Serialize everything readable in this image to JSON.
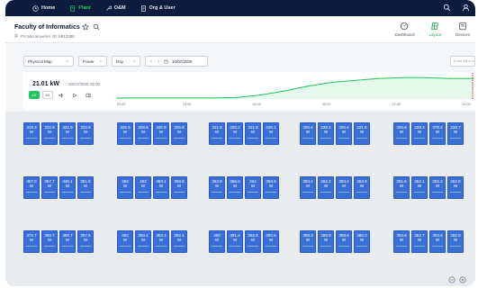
{
  "nav": {
    "items": [
      {
        "label": "Home",
        "icon": "clock-icon",
        "active": false
      },
      {
        "label": "Plant",
        "icon": "plant-icon",
        "active": true
      },
      {
        "label": "O&M",
        "icon": "wrench-icon",
        "active": false
      },
      {
        "label": "Org & User",
        "icon": "org-icon",
        "active": false
      }
    ]
  },
  "header": {
    "title": "Faculty of Informatics",
    "device_type": "PV Microinverter",
    "device_id": "ID: 5913300",
    "views": [
      {
        "label": "Dashboard",
        "active": false
      },
      {
        "label": "Layout",
        "active": true
      },
      {
        "label": "Devices",
        "active": false
      }
    ]
  },
  "filters": {
    "map": "Physical Map",
    "metric": "Power",
    "granularity": "Day",
    "date": "10/07/2025",
    "search_placeholder": "Enter SN to search"
  },
  "chart_panel": {
    "power": "21.01 kW",
    "timestamp": "10/07/2025 15:00",
    "controls": [
      "1X",
      "2X"
    ]
  },
  "chart_data": {
    "type": "area",
    "x_ticks": [
      "00:00",
      "03:00",
      "06:00",
      "09:00",
      "12:00",
      "15:00"
    ],
    "x": [
      "00:00",
      "01:00",
      "02:00",
      "03:00",
      "04:00",
      "05:00",
      "06:00",
      "07:00",
      "08:00",
      "09:00",
      "10:00",
      "11:00",
      "12:00",
      "13:00",
      "14:00",
      "15:00"
    ],
    "values": [
      1,
      1,
      1,
      1,
      1,
      1.5,
      4,
      8,
      13,
      17,
      19,
      21,
      22,
      22,
      21,
      21
    ],
    "cursor": "15:00",
    "color": "#22c55e"
  },
  "panels": {
    "unit": "W",
    "blocks": [
      [
        "319.3",
        "322.9",
        "322.9",
        "322.8"
      ],
      [
        "326.6",
        "328.6",
        "330.8",
        "326.8"
      ],
      [
        "331.8",
        "333.2",
        "331.8",
        "336.1"
      ],
      [
        "326.4",
        "326.4",
        "325.4",
        "321.6"
      ],
      [
        "326.8",
        "328.3",
        "378.2",
        "318.7"
      ],
      [
        "357.8",
        "357.7",
        "345.1",
        "351.5"
      ],
      [
        "363",
        "362",
        "360.1",
        "358.8"
      ],
      [
        "363.8",
        "366.2",
        "364",
        "363.5"
      ],
      [
        "353.4",
        "352.2",
        "353.4",
        "353.9"
      ],
      [
        "351.6",
        "352.1",
        "352.2",
        "352.8"
      ],
      [
        "374.7",
        "350.7",
        "350.7",
        "357.5"
      ],
      [
        "352",
        "353.4",
        "353.4",
        "352.1"
      ],
      [
        "360",
        "391.4",
        "362.6",
        "360.5"
      ],
      [
        "359.3",
        "359.9",
        "359.9",
        "360.3"
      ],
      [
        "354.8",
        "352.7",
        "353.9",
        "352.8"
      ]
    ]
  }
}
